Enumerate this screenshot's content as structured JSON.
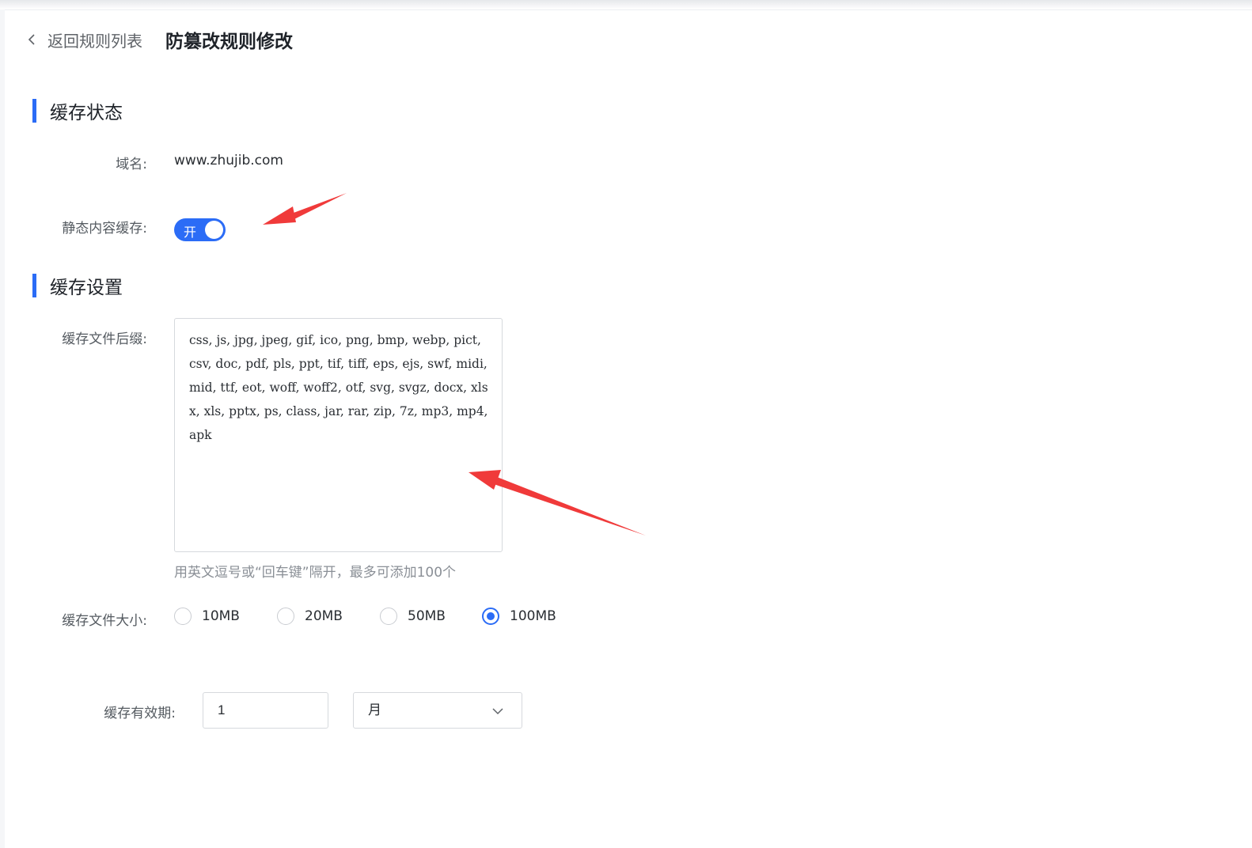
{
  "header": {
    "back_label": "返回规则列表",
    "title": "防篡改规则修改"
  },
  "cache_status": {
    "section_title": "缓存状态",
    "domain_label": "域名:",
    "domain_value": "www.zhujib.com",
    "static_cache_label": "静态内容缓存:",
    "switch_on_text": "开",
    "switch_state": true
  },
  "cache_settings": {
    "section_title": "缓存设置",
    "suffix_label": "缓存文件后缀:",
    "suffix_value": "css, js, jpg, jpeg, gif, ico, png, bmp, webp, pict, csv, doc, pdf, pls, ppt, tif, tiff, eps, ejs, swf, midi, mid, ttf, eot, woff, woff2, otf, svg, svgz, docx, xlsx, xls, pptx, ps, class, jar, rar, zip, 7z, mp3, mp4, apk",
    "suffix_hint": "用英文逗号或“回车键”隔开，最多可添加100个",
    "size_label": "缓存文件大小:",
    "size_options": [
      "10MB",
      "20MB",
      "50MB",
      "100MB"
    ],
    "size_selected": "100MB",
    "validity_label": "缓存有效期:",
    "validity_value": "1",
    "validity_unit": "月"
  },
  "colors": {
    "accent": "#2b6cf6",
    "annotation_arrow": "#f03a3a"
  },
  "icons": {
    "back": "chevron-left-icon",
    "select": "chevron-down-icon"
  }
}
